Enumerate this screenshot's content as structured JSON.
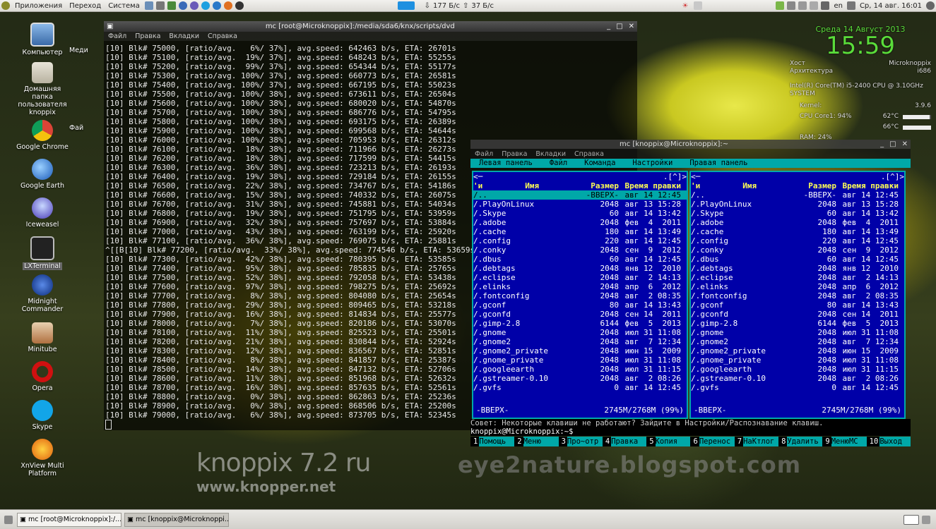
{
  "top_panel": {
    "menus": [
      "Приложения",
      "Переход",
      "Система"
    ],
    "net_down": "177 Б/с",
    "net_up": "37 Б/с",
    "lang": "en",
    "datetime": "Ср, 14 авг. 16:01"
  },
  "desktop_icons": [
    {
      "label": "Компьютер",
      "icon": "computer-icon"
    },
    {
      "label": "Домашняя папка пользователя knoppix",
      "icon": "home-folder-icon"
    },
    {
      "label": "Google Chrome",
      "icon": "chrome-icon"
    },
    {
      "label": "Google Earth",
      "icon": "google-earth-icon"
    },
    {
      "label": "Iceweasel",
      "icon": "iceweasel-icon"
    },
    {
      "label": "LXTerminal",
      "icon": "terminal-icon"
    },
    {
      "label": "Midnight Commander",
      "icon": "mc-icon"
    },
    {
      "label": "Minitube",
      "icon": "minitube-icon"
    },
    {
      "label": "Opera",
      "icon": "opera-icon"
    },
    {
      "label": "Skype",
      "icon": "skype-icon"
    },
    {
      "label": "XnView Multi Platform",
      "icon": "xnview-icon"
    }
  ],
  "desktop_fragments": [
    "Меди",
    "Фай"
  ],
  "terminal1": {
    "title": "mc [root@Microknoppix]:/media/sda6/knx/scripts/dvd",
    "menu": [
      "Файл",
      "Правка",
      "Вкладки",
      "Справка"
    ],
    "lines": [
      "[10] Blk# 75000, [ratio/avg.   6%/ 37%], avg.speed: 642463 b/s, ETA: 26701s",
      "[10] Blk# 75100, [ratio/avg.  19%/ 37%], avg.speed: 648243 b/s, ETA: 55255s",
      "[10] Blk# 75200, [ratio/avg.  99%/ 37%], avg.speed: 654344 b/s, ETA: 55177s",
      "[10] Blk# 75300, [ratio/avg. 100%/ 37%], avg.speed: 660773 b/s, ETA: 26581s",
      "[10] Blk# 75400, [ratio/avg. 100%/ 37%], avg.speed: 667195 b/s, ETA: 55023s",
      "[10] Blk# 75500, [ratio/avg. 100%/ 38%], avg.speed: 673611 b/s, ETA: 26504s",
      "[10] Blk# 75600, [ratio/avg. 100%/ 38%], avg.speed: 680020 b/s, ETA: 54870s",
      "[10] Blk# 75700, [ratio/avg. 100%/ 38%], avg.speed: 686776 b/s, ETA: 54795s",
      "[10] Blk# 75800, [ratio/avg. 100%/ 38%], avg.speed: 693175 b/s, ETA: 26389s",
      "[10] Blk# 75900, [ratio/avg. 100%/ 38%], avg.speed: 699568 b/s, ETA: 54644s",
      "[10] Blk# 76000, [ratio/avg. 100%/ 38%], avg.speed: 705953 b/s, ETA: 26312s",
      "[10] Blk# 76100, [ratio/avg.  18%/ 38%], avg.speed: 711966 b/s, ETA: 26273s",
      "[10] Blk# 76200, [ratio/avg.  18%/ 38%], avg.speed: 717599 b/s, ETA: 54415s",
      "[10] Blk# 76300, [ratio/avg.  36%/ 38%], avg.speed: 723213 b/s, ETA: 26193s",
      "[10] Blk# 76400, [ratio/avg.  19%/ 38%], avg.speed: 729184 b/s, ETA: 26155s",
      "[10] Blk# 76500, [ratio/avg.  22%/ 38%], avg.speed: 734767 b/s, ETA: 54186s",
      "[10] Blk# 76600, [ratio/avg.  15%/ 38%], avg.speed: 740332 b/s, ETA: 26075s",
      "[10] Blk# 76700, [ratio/avg.  31%/ 38%], avg.speed: 745881 b/s, ETA: 54034s",
      "[10] Blk# 76800, [ratio/avg.  19%/ 38%], avg.speed: 751795 b/s, ETA: 53959s",
      "[10] Blk# 76900, [ratio/avg.  32%/ 38%], avg.speed: 757697 b/s, ETA: 53884s",
      "[10] Blk# 77000, [ratio/avg.  43%/ 38%], avg.speed: 763199 b/s, ETA: 25920s",
      "[10] Blk# 77100, [ratio/avg.  36%/ 38%], avg.speed: 769075 b/s, ETA: 25881s",
      "^[[B[10] Blk# 77200, [ratio/avg.  33%/ 38%], avg.speed: 774546 b/s, ETA: 53659s",
      "[10] Blk# 77300, [ratio/avg.  42%/ 38%], avg.speed: 780395 b/s, ETA: 53585s",
      "[10] Blk# 77400, [ratio/avg.  95%/ 38%], avg.speed: 785835 b/s, ETA: 25765s",
      "[10] Blk# 77500, [ratio/avg.  52%/ 38%], avg.speed: 792058 b/s, ETA: 53438s",
      "[10] Blk# 77600, [ratio/avg.  97%/ 38%], avg.speed: 798275 b/s, ETA: 25692s",
      "[10] Blk# 77700, [ratio/avg.   8%/ 38%], avg.speed: 804080 b/s, ETA: 25654s",
      "[10] Blk# 77800, [ratio/avg.  29%/ 38%], avg.speed: 809465 b/s, ETA: 53218s",
      "[10] Blk# 77900, [ratio/avg.  16%/ 38%], avg.speed: 814834 b/s, ETA: 25577s",
      "[10] Blk# 78000, [ratio/avg.   7%/ 38%], avg.speed: 820186 b/s, ETA: 53070s",
      "[10] Blk# 78100, [ratio/avg.  11%/ 38%], avg.speed: 825523 b/s, ETA: 25501s",
      "[10] Blk# 78200, [ratio/avg.  21%/ 38%], avg.speed: 830844 b/s, ETA: 52924s",
      "[10] Blk# 78300, [ratio/avg.  12%/ 38%], avg.speed: 836567 b/s, ETA: 52851s",
      "[10] Blk# 78400, [ratio/avg.   8%/ 38%], avg.speed: 841857 b/s, ETA: 25387s",
      "[10] Blk# 78500, [ratio/avg.  14%/ 38%], avg.speed: 847132 b/s, ETA: 52706s",
      "[10] Blk# 78600, [ratio/avg.  11%/ 38%], avg.speed: 851968 b/s, ETA: 52632s",
      "[10] Blk# 78700, [ratio/avg.  16%/ 38%], avg.speed: 857635 b/s, ETA: 52561s",
      "[10] Blk# 78800, [ratio/avg.   0%/ 38%], avg.speed: 862863 b/s, ETA: 25236s",
      "[10] Blk# 78900, [ratio/avg.   0%/ 38%], avg.speed: 868506 b/s, ETA: 25200s",
      "[10] Blk# 79000, [ratio/avg.   6%/ 38%], avg.speed: 873705 b/s, ETA: 52345s"
    ]
  },
  "mc": {
    "title": "mc [knoppix@Microknoppix]:~",
    "window_menu": [
      "Файл",
      "Правка",
      "Вкладки",
      "Справка"
    ],
    "menubar": [
      "Левая панель",
      "Файл",
      "Команда",
      "Настройки",
      "Правая панель"
    ],
    "col_headers": {
      "marker": "'и",
      "name": "Имя",
      "size": "Размер",
      "mtime": "Время правки"
    },
    "panel_corner": ".[^]>",
    "files": [
      {
        "name": "/..",
        "size": "-ВВЕРХ-",
        "date": "авг 14 12:45"
      },
      {
        "name": "/.PlayOnLinux",
        "size": "2048",
        "date": "авг 13 15:28"
      },
      {
        "name": "/.Skype",
        "size": "60",
        "date": "авг 14 13:42"
      },
      {
        "name": "/.adobe",
        "size": "2048",
        "date": "фев  4  2011"
      },
      {
        "name": "/.cache",
        "size": "180",
        "date": "авг 14 13:49"
      },
      {
        "name": "/.config",
        "size": "220",
        "date": "авг 14 12:45"
      },
      {
        "name": "/.conky",
        "size": "2048",
        "date": "сен  9  2012"
      },
      {
        "name": "/.dbus",
        "size": "60",
        "date": "авг 14 12:45"
      },
      {
        "name": "/.debtags",
        "size": "2048",
        "date": "янв 12  2010"
      },
      {
        "name": "/.eclipse",
        "size": "2048",
        "date": "авг  2 14:13"
      },
      {
        "name": "/.elinks",
        "size": "2048",
        "date": "апр  6  2012"
      },
      {
        "name": "/.fontconfig",
        "size": "2048",
        "date": "авг  2 08:35"
      },
      {
        "name": "/.gconf",
        "size": "80",
        "date": "авг 14 13:43"
      },
      {
        "name": "/.gconfd",
        "size": "2048",
        "date": "сен 14  2011"
      },
      {
        "name": "/.gimp-2.8",
        "size": "6144",
        "date": "фев  5  2013"
      },
      {
        "name": "/.gnome",
        "size": "2048",
        "date": "июл 31 11:08"
      },
      {
        "name": "/.gnome2",
        "size": "2048",
        "date": "авг  7 12:34"
      },
      {
        "name": "/.gnome2_private",
        "size": "2048",
        "date": "июн 15  2009"
      },
      {
        "name": "/.gnome_private",
        "size": "2048",
        "date": "июл 31 11:08"
      },
      {
        "name": "/.googleearth",
        "size": "2048",
        "date": "июл 31 11:15"
      },
      {
        "name": "/.gstreamer-0.10",
        "size": "2048",
        "date": "авг  2 08:26"
      },
      {
        "name": "/.gvfs",
        "size": "0",
        "date": "авг 14 12:45"
      }
    ],
    "mini_status": "-ВВЕРХ-",
    "free_space": "2745M/2768M (99%)",
    "hint": "Совет: Некоторые клавиши не работают? Зайдите в Настройки/Распознавание клавиш.",
    "prompt": "knoppix@Microknoppix:~$",
    "fkeys": [
      {
        "num": "1",
        "label": "Помощь"
      },
      {
        "num": "2",
        "label": "Меню"
      },
      {
        "num": "3",
        "label": "Про~отр"
      },
      {
        "num": "4",
        "label": "Правка"
      },
      {
        "num": "5",
        "label": "Копия"
      },
      {
        "num": "6",
        "label": "Перенос"
      },
      {
        "num": "7",
        "label": "НаКтлог"
      },
      {
        "num": "8",
        "label": "Удалить"
      },
      {
        "num": "9",
        "label": "МенюMC"
      },
      {
        "num": "10",
        "label": "Выход"
      }
    ]
  },
  "conky": {
    "date": "Среда 14 Август 2013",
    "time": "15:59",
    "host_label": "Хост",
    "host": "Microknoppix",
    "arch_label": "Архитектура",
    "arch": "i686",
    "cpu_name": "Intel(R) Core(TM) i5-2400 CPU @ 3.10GHz",
    "system_label": "SYSTEM",
    "kernel_label": "Kernel:",
    "kernel": "3.9.6",
    "cpu1_label": "CPU Core1: 94%",
    "cpu1_temp": "62°C",
    "cpu1_percent": 94,
    "cpu2_temp": "66°C",
    "ram_label": "RAM: 24%",
    "ram_percent": 24
  },
  "watermarks": {
    "w1": "knoppix 7.2 ru",
    "w2": "www.knopper.net",
    "w3": "eye2nature.blogspot.com"
  },
  "taskbar": {
    "tasks": [
      "mc [root@Microknoppix]:/...",
      "mc [knoppix@Microknoppi..."
    ]
  }
}
